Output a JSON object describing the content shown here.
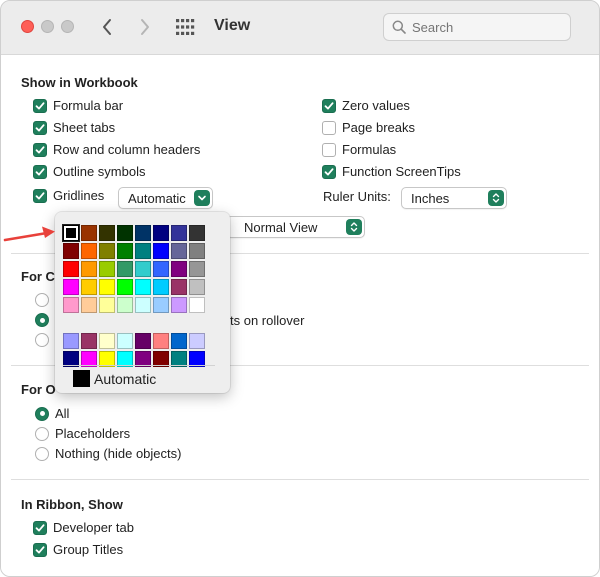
{
  "window": {
    "title": "View",
    "search_placeholder": "Search"
  },
  "show_in_workbook": {
    "heading": "Show in Workbook",
    "left": [
      {
        "label": "Formula bar",
        "checked": true
      },
      {
        "label": "Sheet tabs",
        "checked": true
      },
      {
        "label": "Row and column headers",
        "checked": true
      },
      {
        "label": "Outline symbols",
        "checked": true
      },
      {
        "label": "Gridlines",
        "checked": true
      }
    ],
    "right": [
      {
        "label": "Zero values",
        "checked": true
      },
      {
        "label": "Page breaks",
        "checked": false
      },
      {
        "label": "Formulas",
        "checked": false
      },
      {
        "label": "Function ScreenTips",
        "checked": true
      }
    ],
    "gridline_color_value": "Automatic",
    "ruler_units_label": "Ruler Units:",
    "ruler_units_value": "Inches",
    "view_value": "Normal View"
  },
  "comments_section": {
    "heading_visible": "For C",
    "rollover_text_visible": "ts on rollover"
  },
  "objects_section": {
    "heading_visible": "For O",
    "options": [
      {
        "label": "All",
        "selected": true
      },
      {
        "label": "Placeholders",
        "selected": false
      },
      {
        "label": "Nothing (hide objects)",
        "selected": false
      }
    ]
  },
  "ribbon_section": {
    "heading": "In Ribbon, Show",
    "options": [
      {
        "label": "Developer tab",
        "checked": true
      },
      {
        "label": "Group Titles",
        "checked": true
      }
    ]
  },
  "color_popover": {
    "automatic_label": "Automatic",
    "rows": [
      [
        "#000000",
        "#993300",
        "#333300",
        "#003300",
        "#003366",
        "#000080",
        "#333399",
        "#333333"
      ],
      [
        "#800000",
        "#FF6600",
        "#808000",
        "#008000",
        "#008080",
        "#0000FF",
        "#666699",
        "#808080"
      ],
      [
        "#FF0000",
        "#FF9900",
        "#99CC00",
        "#339966",
        "#33CCCC",
        "#3366FF",
        "#800080",
        "#969696"
      ],
      [
        "#FF00FF",
        "#FFCC00",
        "#FFFF00",
        "#00FF00",
        "#00FFFF",
        "#00CCFF",
        "#993366",
        "#C0C0C0"
      ],
      [
        "#FF99CC",
        "#FFCC99",
        "#FFFF99",
        "#CCFFCC",
        "#CCFFFF",
        "#99CCFF",
        "#CC99FF",
        "#FFFFFF"
      ],
      [
        "#9999FF",
        "#993366",
        "#FFFFCC",
        "#CCFFFF",
        "#660066",
        "#FF8080",
        "#0066CC",
        "#CCCCFF"
      ],
      [
        "#000080",
        "#FF00FF",
        "#FFFF00",
        "#00FFFF",
        "#800080",
        "#800000",
        "#008080",
        "#0000FF"
      ]
    ],
    "selected_color": "#000000"
  },
  "colors": {
    "accent": "#1f7f5c",
    "annotation_arrow": "#e8413b"
  }
}
